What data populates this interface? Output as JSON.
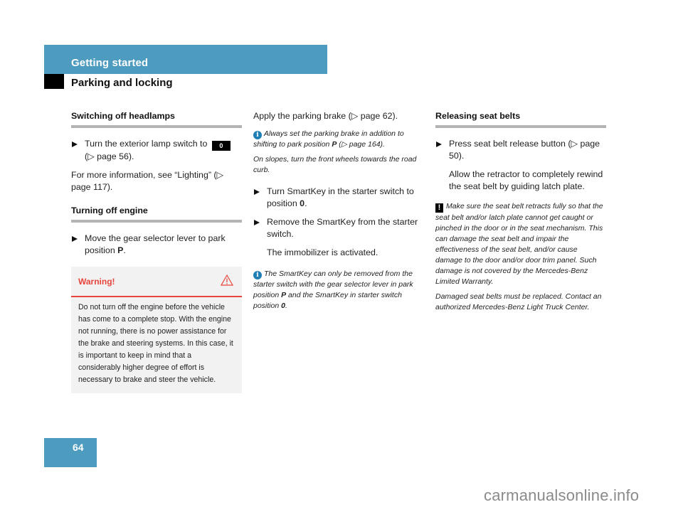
{
  "header": {
    "chapter": "Getting started",
    "section": "Parking and locking"
  },
  "column1": {
    "headlamps": {
      "heading": "Switching off headlamps",
      "bullet_text": "Turn the exterior lamp switch to",
      "switch_position": "0",
      "bullet_ref": "(▷ page 56).",
      "more_info": "For more information, see “Lighting” (▷ page 117)."
    },
    "engine": {
      "heading": "Turning off engine",
      "bullet_text": "Move the gear selector lever to park position ",
      "bullet_bold": "P",
      "bullet_end": "."
    },
    "warning": {
      "label": "Warning!",
      "icon": "warning-triangle-icon",
      "body": "Do not turn off the engine before the vehicle has come to a complete stop. With the engine not running, there is no power assistance for the brake and steering systems. In this case, it is important to keep in mind that a considerably higher degree of effort is necessary to brake and steer the vehicle."
    }
  },
  "column2": {
    "intro": "Apply the parking brake (▷ page 62).",
    "note1": {
      "icon": "info-icon",
      "text_a": "Always set the parking brake in addition to shifting to park position ",
      "bold": "P",
      "text_b": " (▷ page 164)."
    },
    "note1_extra": "On slopes, turn the front wheels towards the road curb.",
    "bullets": [
      {
        "text": "Turn SmartKey in the starter switch to position ",
        "bold": "0",
        "end": "."
      },
      {
        "text": "Remove the SmartKey from the starter switch.",
        "bold": "",
        "end": ""
      }
    ],
    "result": "The immobilizer is activated.",
    "note2": {
      "icon": "info-icon",
      "text_a": "The SmartKey can only be removed from the starter switch with the gear selector lever in park position ",
      "bold1": "P",
      "text_b": " and the SmartKey in starter switch position ",
      "bold2": "0",
      "text_c": "."
    }
  },
  "column3": {
    "heading": "Releasing seat belts",
    "bullet_text": "Press seat belt release button (▷ page 50).",
    "followup": "Allow the retractor to completely rewind the seat belt by guiding latch plate.",
    "caution": {
      "icon": "exclamation-icon",
      "text": "Make sure the seat belt retracts fully so that the seat belt and/or latch plate cannot get caught or pinched in the door or in the seat mechanism. This can damage the seat belt and impair the effectiveness of the seat belt, and/or cause damage to the door and/or door trim panel. Such damage is not covered by the Mercedes-Benz Limited Warranty."
    },
    "caution_extra": "Damaged seat belts must be replaced. Contact an authorized Mercedes-Benz Light Truck Center."
  },
  "footer": {
    "page_number": "64",
    "watermark": "carmanualsonline.info"
  },
  "colors": {
    "accent_blue": "#4d9bbf",
    "warning_red": "#e8453c",
    "info_blue": "#1f7fb5"
  }
}
